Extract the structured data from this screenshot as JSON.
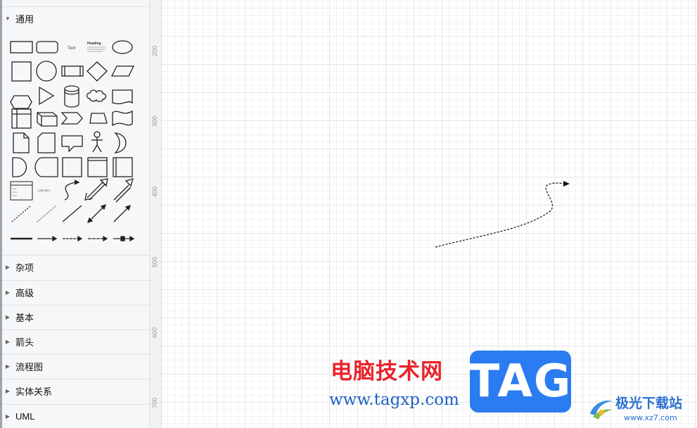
{
  "sidebar": {
    "general": {
      "label": "通用",
      "expanded": true
    },
    "sections": [
      {
        "label": "杂项"
      },
      {
        "label": "高级"
      },
      {
        "label": "基本"
      },
      {
        "label": "箭头"
      },
      {
        "label": "流程图"
      },
      {
        "label": "实体关系"
      },
      {
        "label": "UML"
      }
    ],
    "shape_text": {
      "text": "Text",
      "heading": "Heading",
      "list_item": "List Item"
    }
  },
  "ruler": {
    "ticks": [
      "200",
      "300",
      "400",
      "500",
      "600",
      "700"
    ]
  },
  "watermark": {
    "brand_cn": "电脑技术网",
    "brand_tag": "TAG",
    "url": "www.tagxp.com",
    "site_cn": "极光下载站",
    "site_url": "www.xz7.com"
  },
  "colors": {
    "tag_blue": "#2a7cf0",
    "brand_red": "#e8242a",
    "url_blue": "#1f61c6"
  }
}
